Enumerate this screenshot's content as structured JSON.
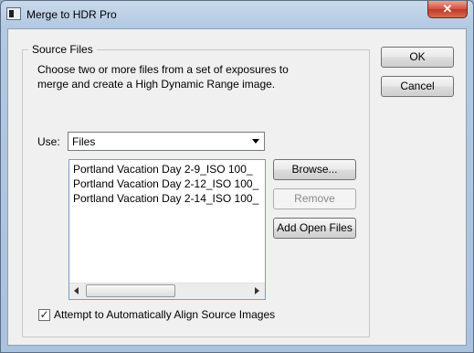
{
  "window": {
    "title": "Merge to HDR Pro",
    "close_symbol": "✕",
    "icon": "hdr-app-icon"
  },
  "source_files": {
    "legend": "Source Files",
    "description_line1": "Choose two or more files from a set of exposures to",
    "description_line2": "merge and create a High Dynamic Range image.",
    "use_label": "Use:",
    "use_value": "Files",
    "files": [
      "Portland Vacation Day 2-9_ISO 100_",
      "Portland Vacation Day 2-12_ISO 100_",
      "Portland Vacation Day 2-14_ISO 100_"
    ],
    "browse_label": "Browse...",
    "remove_label": "Remove",
    "add_open_files_label": "Add Open Files",
    "align_checkbox_label": "Attempt to Automatically Align Source Images",
    "align_checked": true,
    "check_symbol": "✓"
  },
  "dialog_buttons": {
    "ok_label": "OK",
    "cancel_label": "Cancel"
  }
}
